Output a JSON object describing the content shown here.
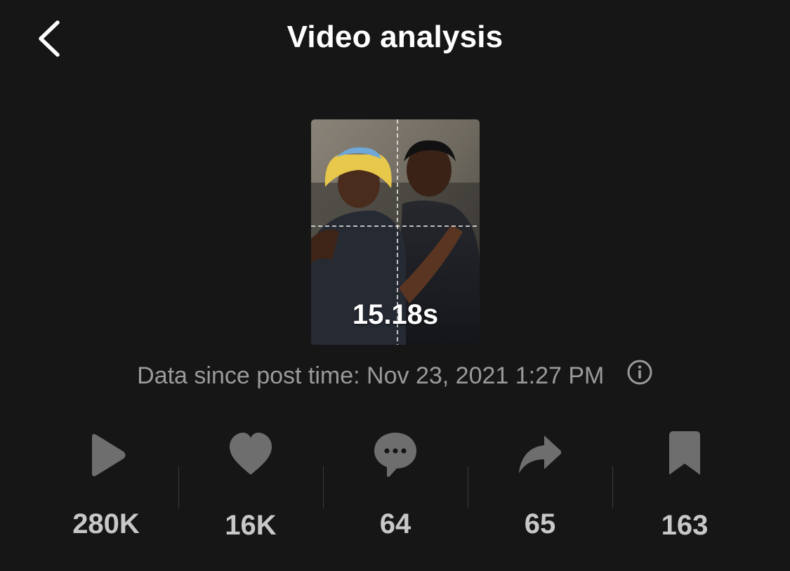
{
  "header": {
    "title": "Video analysis",
    "back_icon": "chevron-left-icon"
  },
  "video": {
    "duration": "15.18s",
    "thumbnail_icon": "video-thumbnail"
  },
  "post_time": {
    "text": "Data since post time: Nov 23, 2021 1:27 PM",
    "info_icon": "info-circle-icon"
  },
  "stats": [
    {
      "icon": "play-icon",
      "value": "280K"
    },
    {
      "icon": "heart-icon",
      "value": "16K"
    },
    {
      "icon": "comment-icon",
      "value": "64"
    },
    {
      "icon": "share-icon",
      "value": "65"
    },
    {
      "icon": "bookmark-icon",
      "value": "163"
    }
  ],
  "colors": {
    "background": "#161616",
    "text_primary": "#ffffff",
    "text_secondary": "#9a9a9a",
    "icon": "#6e6e6e",
    "stat_value": "#c8c8c8"
  }
}
